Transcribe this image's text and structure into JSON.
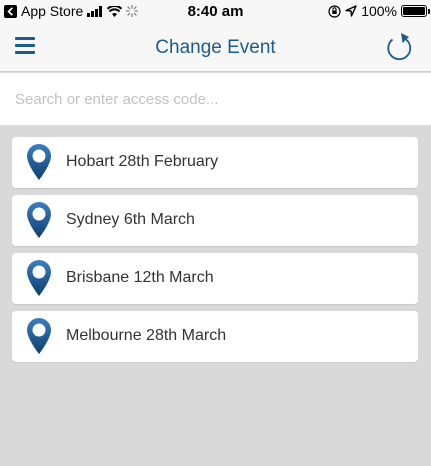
{
  "status_bar": {
    "back_app": "App Store",
    "time": "8:40 am",
    "battery": "100%",
    "icons": [
      "back-arrow-icon",
      "signal-icon",
      "wifi-icon",
      "activity-spinner-icon",
      "orientation-lock-icon",
      "location-arrow-icon",
      "battery-icon"
    ]
  },
  "nav": {
    "title": "Change Event",
    "left_icon": "hamburger-menu-icon",
    "right_icon": "refresh-icon",
    "accent_color": "#1d5a8e"
  },
  "search": {
    "placeholder": "Search or enter access code...",
    "value": ""
  },
  "events": [
    {
      "label": "Hobart 28th February",
      "icon": "map-pin-icon"
    },
    {
      "label": "Sydney 6th March",
      "icon": "map-pin-icon"
    },
    {
      "label": "Brisbane 12th March",
      "icon": "map-pin-icon"
    },
    {
      "label": "Melbourne 28th March",
      "icon": "map-pin-icon"
    }
  ]
}
